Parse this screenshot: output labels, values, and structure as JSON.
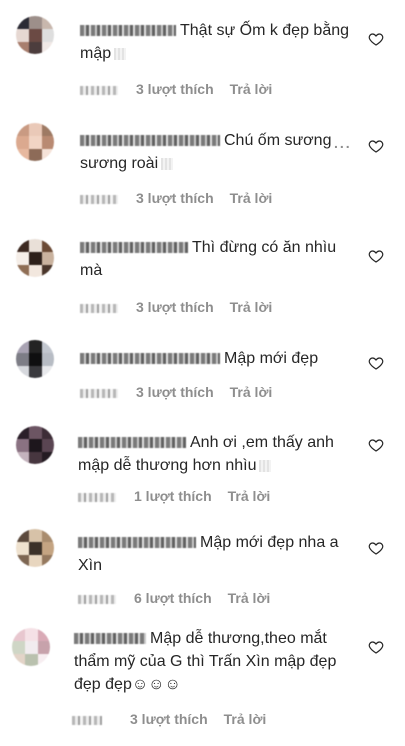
{
  "comments": [
    {
      "text": "Thật sự Ốm k đẹp bằng mập",
      "likes_label": "3 lượt thích",
      "reply_label": "Trả lời",
      "avatar_colors": [
        "#2b2b35",
        "#9d8f8a",
        "#c8b7ad",
        "#e6d8d2",
        "#6b4a44",
        "#dedede",
        "#a87e6e",
        "#4c3d3d",
        "#f0e8e5"
      ]
    },
    {
      "text": "Chú ốm sương sương roài",
      "likes_label": "3 lượt thích",
      "reply_label": "Trả lời",
      "avatar_colors": [
        "#c99a82",
        "#eac9b8",
        "#9e7a64",
        "#dba98f",
        "#f1d4c4",
        "#b98a72",
        "#e7b89f",
        "#8d6b58",
        "#f5e2d8"
      ]
    },
    {
      "text": "Thì đừng có ăn nhìu mà",
      "likes_label": "3 lượt thích",
      "reply_label": "Trả lời",
      "avatar_colors": [
        "#3d2a22",
        "#e9e0d8",
        "#6b4a35",
        "#f5eee8",
        "#2d201a",
        "#c9b29e",
        "#8f6e55",
        "#f2e7de",
        "#4a362b"
      ]
    },
    {
      "text": "Mập mới đẹp",
      "likes_label": "3 lượt thích",
      "reply_label": "Trả lời",
      "avatar_colors": [
        "#a9a3b3",
        "#232323",
        "#c2c7cf",
        "#7d7d86",
        "#0f0f10",
        "#b7bcc4",
        "#d6d8dd",
        "#3a3a3e",
        "#e8e9ec"
      ]
    },
    {
      "text": "Anh ơi ,em thấy anh mập dễ thương hơn nhìu",
      "likes_label": "1 lượt thích",
      "reply_label": "Trả lời",
      "avatar_colors": [
        "#2a1f29",
        "#6c5563",
        "#3d2d37",
        "#8a7282",
        "#1d161c",
        "#5a4552",
        "#c4b3bd",
        "#47363f",
        "#241b22"
      ]
    },
    {
      "text": "Mập mới đẹp nha a Xìn",
      "likes_label": "6 lượt thích",
      "reply_label": "Trả lời",
      "avatar_colors": [
        "#5c4a3d",
        "#d7c2a8",
        "#a98c6e",
        "#efe2cf",
        "#3c3128",
        "#c4a482",
        "#7d6652",
        "#e8d6bf",
        "#95795f"
      ]
    },
    {
      "text": "Mập dễ thương,theo mắt thẩm mỹ của G thì Trấn Xìn mập đẹp đẹp đẹp☺☺☺",
      "likes_label": "3 lượt thích",
      "reply_label": "Trả lời",
      "avatar_colors": [
        "#e8c7cf",
        "#f5e1e6",
        "#d9aab6",
        "#cfd6c6",
        "#f1ecef",
        "#c7a2ab",
        "#e3d4c8",
        "#b9c1ae",
        "#f7eef1"
      ]
    }
  ],
  "more_label": "..."
}
